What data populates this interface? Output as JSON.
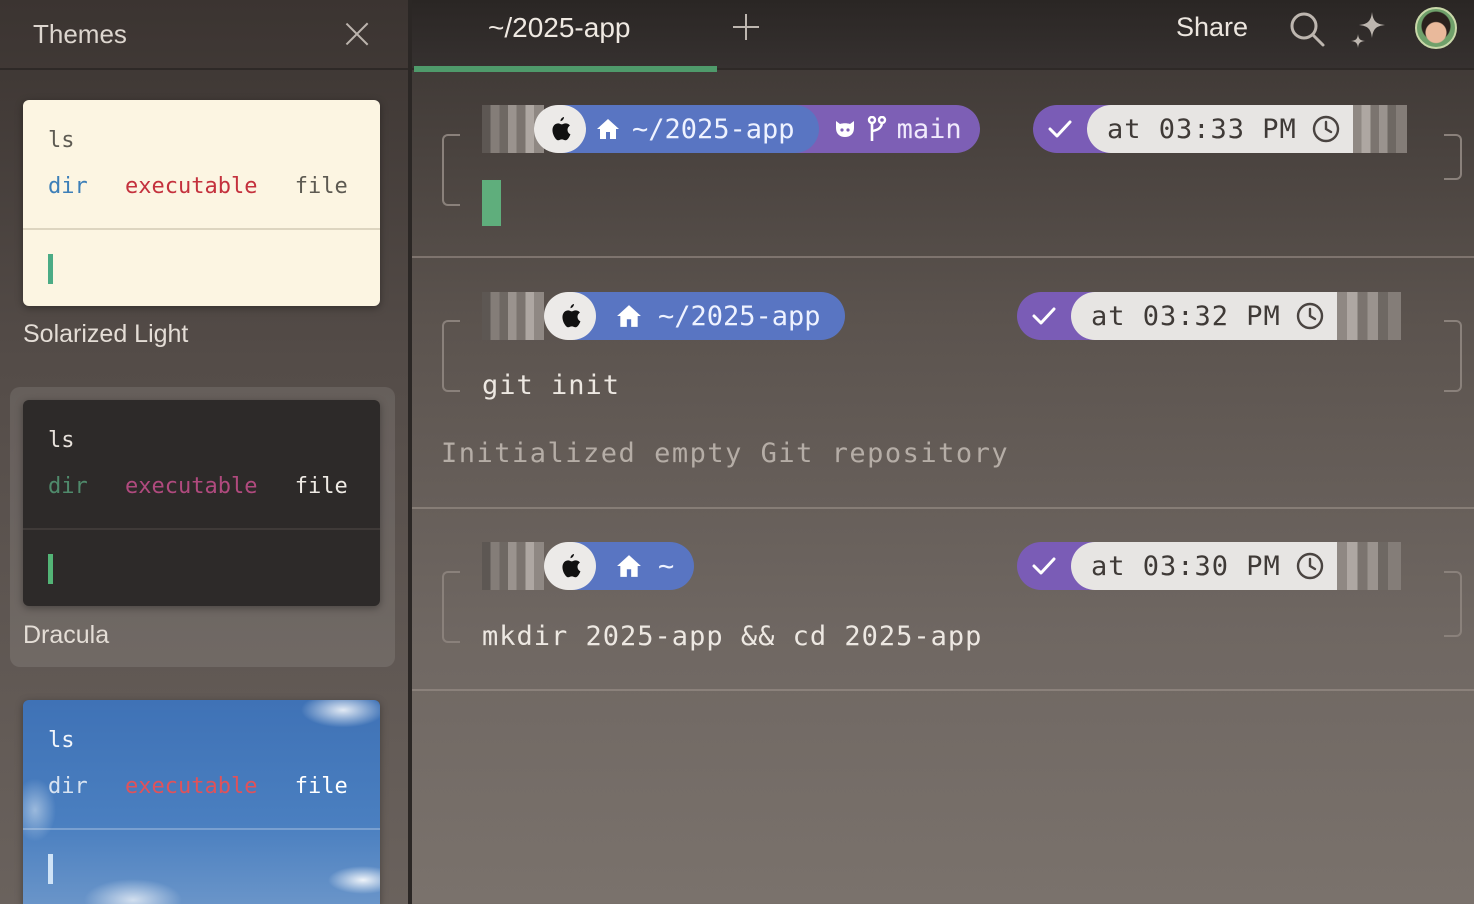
{
  "sidebar": {
    "title": "Themes",
    "themes": [
      {
        "name": "Solarized Light",
        "cmd": "ls",
        "dir": "dir",
        "exe": "executable",
        "file": "file"
      },
      {
        "name": "Dracula",
        "cmd": "ls",
        "dir": "dir",
        "exe": "executable",
        "file": "file"
      },
      {
        "name": "",
        "cmd": "ls",
        "dir": "dir",
        "exe": "executable",
        "file": "file"
      }
    ]
  },
  "topbar": {
    "tab_label": "~/2025-app",
    "share_label": "Share"
  },
  "blocks": [
    {
      "path": "~/2025-app",
      "branch": "main",
      "time": "at 03:33 PM",
      "command": "",
      "output": ""
    },
    {
      "path": "~/2025-app",
      "branch": "",
      "time": "at 03:32 PM",
      "command": "git init",
      "output": "Initialized empty Git repository"
    },
    {
      "path": "~",
      "branch": "",
      "time": "at 03:30 PM",
      "command": "mkdir 2025-app && cd 2025-app",
      "output": ""
    }
  ],
  "colors": {
    "accent_green": "#4f9a6b",
    "path_blue": "#5975c2",
    "status_purple": "#7a5cb6"
  }
}
